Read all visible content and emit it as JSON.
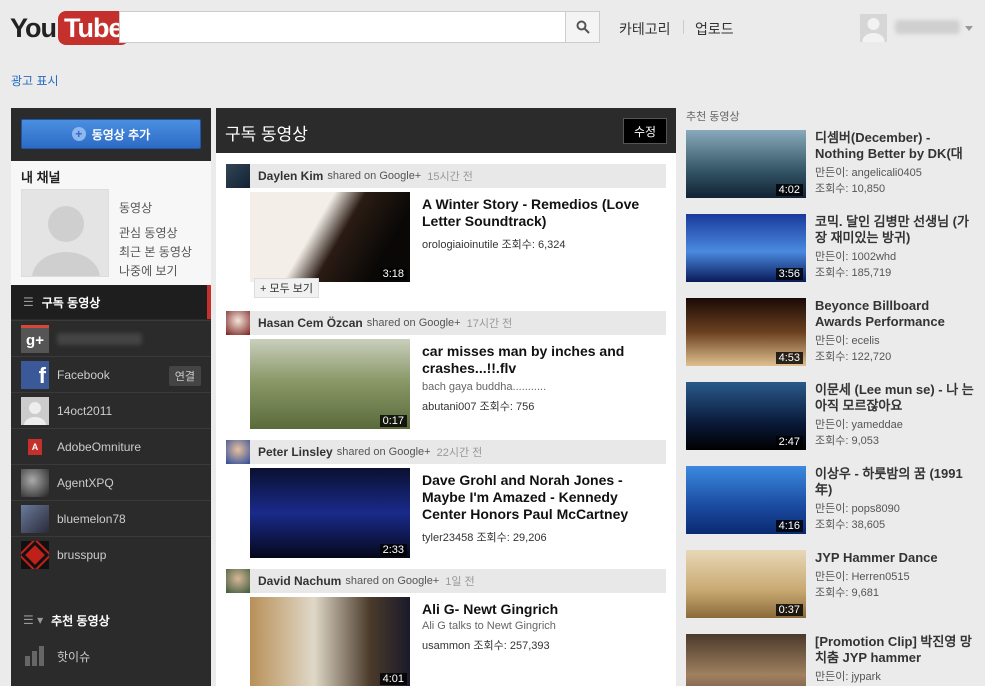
{
  "masthead": {
    "logo_you": "You",
    "logo_tube": "Tube",
    "category_link": "카테고리",
    "upload_link": "업로드",
    "search_placeholder": ""
  },
  "ad_link": "광고 표시",
  "sidebar": {
    "upload_button": "동영상 추가",
    "my_channel": "내 채널",
    "channel_links": [
      "동영상",
      "관심 동영상",
      "최근 본 동영상",
      "나중에 보기"
    ],
    "subscriptions_header": "구독 동영상",
    "subscriptions": [
      {
        "label": "",
        "icon": "gplus"
      },
      {
        "label": "Facebook",
        "icon": "facebook",
        "action": "연결"
      },
      {
        "label": "14oct2011",
        "icon": "default-avatar"
      },
      {
        "label": "AdobeOmniture",
        "icon": "adobe"
      },
      {
        "label": "AgentXPQ",
        "icon": "agent"
      },
      {
        "label": "bluemelon78",
        "icon": "bluemelon"
      },
      {
        "label": "brusspup",
        "icon": "brusspup"
      }
    ],
    "recommended_header": "추천 동영상",
    "trending": "핫이슈"
  },
  "feed": {
    "title": "구독 동영상",
    "edit_button": "수정",
    "items": [
      {
        "user": "Daylen Kim",
        "shared": "shared on Google+",
        "time": "15시간 전",
        "title": "A Winter Story - Remedios (Love Letter Soundtrack)",
        "desc": "",
        "uploader": "orologiaioinutile",
        "views_label": "조회수:",
        "views": "6,324",
        "duration": "3:18",
        "more": "+ 모두 보기"
      },
      {
        "user": "Hasan Cem Özcan",
        "shared": "shared on Google+",
        "time": "17시간 전",
        "title": "car misses man by inches and crashes...!!.flv",
        "desc": "bach gaya buddha...........",
        "uploader": "abutani007",
        "views_label": "조회수:",
        "views": "756",
        "duration": "0:17"
      },
      {
        "user": "Peter Linsley",
        "shared": "shared on Google+",
        "time": "22시간 전",
        "title": "Dave Grohl and Norah Jones - Maybe I'm Amazed - Kennedy Center Honors Paul McCartney",
        "desc": "",
        "uploader": "tyler23458",
        "views_label": "조회수:",
        "views": "29,206",
        "duration": "2:33"
      },
      {
        "user": "David Nachum",
        "shared": "shared on Google+",
        "time": "1일 전",
        "title": "Ali G- Newt Gingrich",
        "desc": "Ali G talks to Newt Gingrich",
        "uploader": "usammon",
        "views_label": "조회수:",
        "views": "257,393",
        "duration": "4:01"
      }
    ]
  },
  "recommended": {
    "title": "추천 동영상",
    "items": [
      {
        "title": "디셈버(December) - Nothing Better by DK(대",
        "by_label": "만든이:",
        "by": "angelicali0405",
        "views_label": "조회수:",
        "views": "10,850",
        "duration": "4:02"
      },
      {
        "title": "코믹. 달인 김병만 선생님 (가장 재미있는 방귀)",
        "by_label": "만든이:",
        "by": "1002whd",
        "views_label": "조회수:",
        "views": "185,719",
        "duration": "3:56"
      },
      {
        "title": "Beyonce Billboard Awards Performance",
        "by_label": "만든이:",
        "by": "ecelis",
        "views_label": "조회수:",
        "views": "122,720",
        "duration": "4:53"
      },
      {
        "title": "이문세 (Lee mun se) - 나 는 아직 모르잖아요",
        "by_label": "만든이:",
        "by": "yameddae",
        "views_label": "조회수:",
        "views": "9,053",
        "duration": "2:47"
      },
      {
        "title": "이상우 - 하룻밤의 꿈 (1991年)",
        "by_label": "만든이:",
        "by": "pops8090",
        "views_label": "조회수:",
        "views": "38,605",
        "duration": "4:16"
      },
      {
        "title": "JYP Hammer Dance",
        "by_label": "만든이:",
        "by": "Herren0515",
        "views_label": "조회수:",
        "views": "9,681",
        "duration": "0:37"
      },
      {
        "title": "[Promotion Clip] 박진영 망치춤 JYP hammer",
        "by_label": "만든이:",
        "by": "jypark",
        "views_label": "",
        "views": "",
        "duration": ""
      }
    ]
  }
}
